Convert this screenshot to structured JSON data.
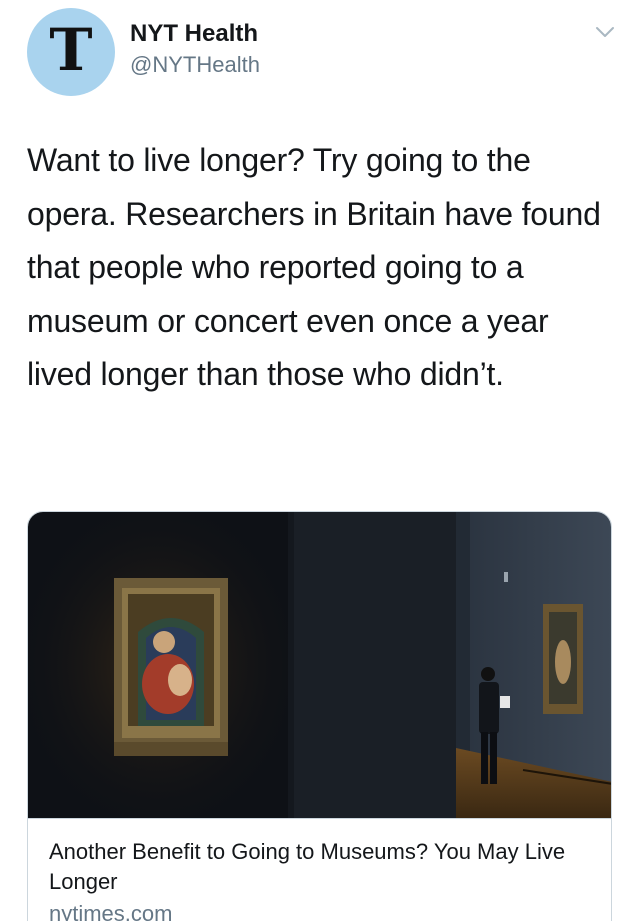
{
  "author": {
    "avatar_glyph": "T",
    "avatar_icon": "nyt-logo-icon",
    "display_name": "NYT Health",
    "handle": "@NYTHealth"
  },
  "menu": {
    "icon": "chevron-down-icon"
  },
  "tweet": {
    "text": "Want to live longer? Try going to the opera. Researchers in Britain have found that people who reported going to a museum or concert even once a year lived longer than those who didn’t."
  },
  "card": {
    "title": "Another Benefit to Going to Museums? You May Live Longer",
    "domain": "nytimes.com"
  },
  "colors": {
    "avatar_bg": "#a9d3ee",
    "text_primary": "#14171a",
    "text_secondary": "#657786",
    "border": "#ccd6dd"
  }
}
